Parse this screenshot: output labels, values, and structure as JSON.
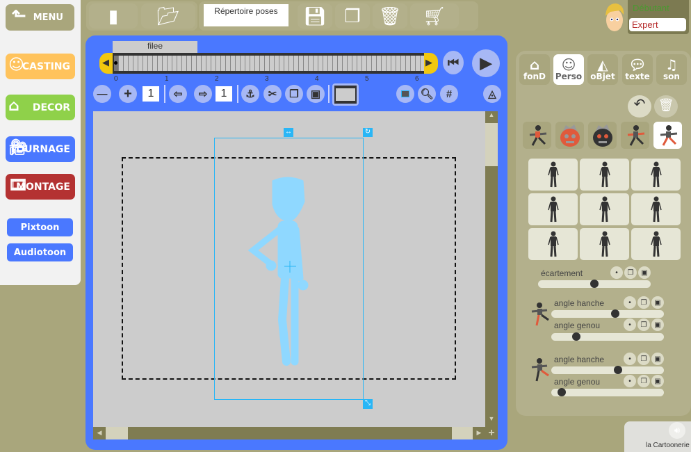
{
  "menu": {
    "label": "MENU"
  },
  "nav": [
    {
      "label": "CASTING",
      "color": "#ffc35c"
    },
    {
      "label": "DECOR",
      "color": "#8fd14a"
    },
    {
      "label": "TOURNAGE",
      "color": "#4a78ff"
    },
    {
      "label": "MONTAGE",
      "color": "#b43232"
    }
  ],
  "links": [
    "Pixtoon",
    "Audiotoon"
  ],
  "toolbar": {
    "directory": "Répertoire poses",
    "icons": [
      "new-file",
      "open-folder",
      "save",
      "duplicate",
      "trash",
      "cart"
    ]
  },
  "level": {
    "beginner": "Débutant",
    "expert": "Expert",
    "selected": "Expert"
  },
  "timeline": {
    "track_name": "filee",
    "ticks": [
      "0",
      "1",
      "2",
      "3",
      "4",
      "5",
      "6"
    ],
    "current_frame": 0
  },
  "controls": {
    "step_value": "1",
    "frame_value": "1"
  },
  "tabs": [
    {
      "label": "fonD",
      "icon": "house"
    },
    {
      "label": "Perso",
      "icon": "character",
      "active": true
    },
    {
      "label": "oBjet",
      "icon": "shapes"
    },
    {
      "label": "texte",
      "icon": "speech-bubble"
    },
    {
      "label": "son",
      "icon": "music-note"
    }
  ],
  "sliders": {
    "ecartement": {
      "label": "écartement",
      "value": 0.5
    },
    "leg1": [
      {
        "label": "angle hanche",
        "value": 0.57
      },
      {
        "label": "angle genou",
        "value": 0.22
      }
    ],
    "leg2": [
      {
        "label": "angle hanche",
        "value": 0.59
      },
      {
        "label": "angle genou",
        "value": 0.09
      }
    ]
  },
  "footer": {
    "brand": "la Cartoonerie"
  },
  "colors": {
    "accent": "#4a78ff",
    "selection": "#29b6f6",
    "figure": "#8fd8ff"
  }
}
